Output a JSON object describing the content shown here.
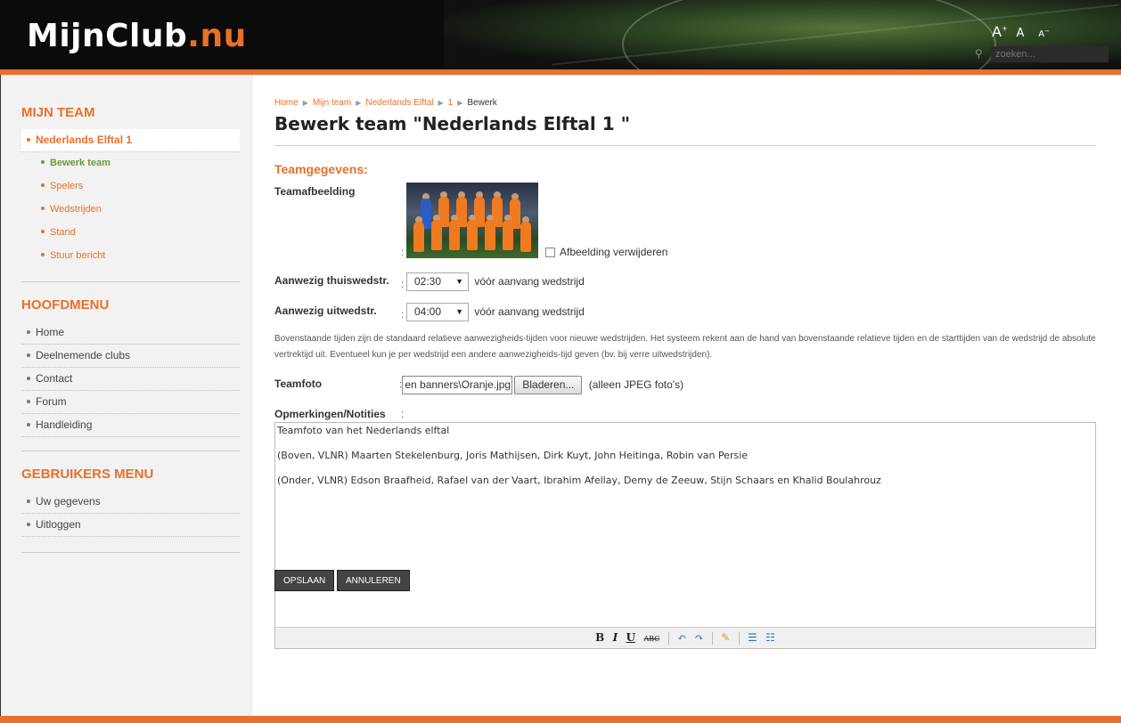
{
  "header": {
    "logo_main": "MijnClub",
    "logo_ext": ".nu",
    "font_sizes": [
      "A",
      "A",
      "A"
    ],
    "search_placeholder": "zoeken..."
  },
  "sidebar": {
    "my_team_title": "MIJN TEAM",
    "team_name": "Nederlands Elftal 1",
    "team_sub": [
      "Bewerk team",
      "Spelers",
      "Wedstrijden",
      "Stand",
      "Stuur bericht"
    ],
    "main_menu_title": "HOOFDMENU",
    "main_menu": [
      "Home",
      "Deelnemende clubs",
      "Contact",
      "Forum",
      "Handleiding"
    ],
    "user_menu_title": "GEBRUIKERS MENU",
    "user_menu": [
      "Uw gegevens",
      "Uitloggen"
    ]
  },
  "breadcrumb": [
    "Home",
    "Mijn team",
    "Nederlands Elftal",
    "1",
    "Bewerk"
  ],
  "page_title": "Bewerk team \"Nederlands Elftal 1 \"",
  "section_title": "Teamgegevens:",
  "form": {
    "team_image_label": "Teamafbeelding",
    "remove_image_label": "Afbeelding verwijderen",
    "home_label": "Aanwezig thuiswedstr.",
    "home_value": "02:30",
    "away_label": "Aanwezig uitwedstr.",
    "away_value": "04:00",
    "before_start": "vóór aanvang wedstrijd",
    "hint": "Bovenstaande tijden zijn de standaard relatieve aanwezigheids-tijden voor nieuwe wedstrijden. Het systeem rekent aan de hand van bovenstaande relatieve tijden en de starttijden van de wedstrijd de absolute vertrektijd uit. Eventueel kun je per wedstrijd een andere aanwezigheids-tijd geven (bv. bij verre uitwedstrijden).",
    "team_photo_label": "Teamfoto",
    "file_value": "en banners\\Oranje.jpg",
    "browse_label": "Bladeren...",
    "jpeg_note": "(alleen JPEG foto's)",
    "notes_label": "Opmerkingen/Notities"
  },
  "notes": [
    "Teamfoto van het Nederlands elftal",
    "(Boven, VLNR) Maarten Stekelenburg, Joris Mathijsen, Dirk Kuyt, John Heitinga, Robin van Persie",
    "(Onder, VLNR) Edson Braafheid, Rafael van der Vaart, Ibrahim Afellay, Demy de Zeeuw, Stijn Schaars en Khalid Boulahrouz"
  ],
  "toolbar": {
    "bold": "B",
    "italic": "I",
    "underline": "U",
    "strike": "ABC"
  },
  "buttons": {
    "save": "OPSLAAN",
    "cancel": "ANNULEREN"
  },
  "colors": {
    "accent": "#e8702a",
    "active_sub": "#6d9a3c",
    "button": "#444444"
  }
}
